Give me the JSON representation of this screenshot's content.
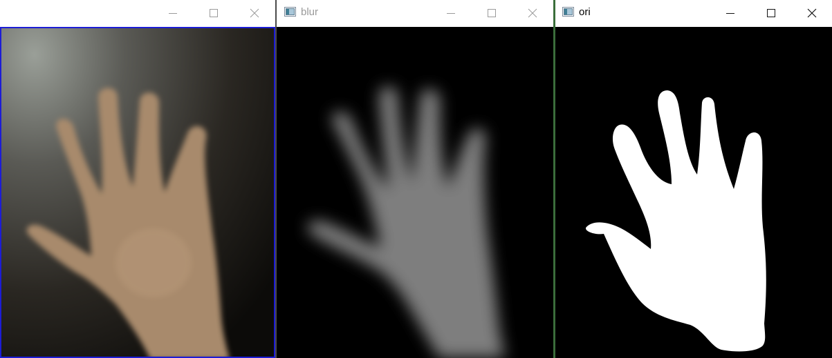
{
  "windows": [
    {
      "title": "",
      "active": false
    },
    {
      "title": "blur",
      "active": false
    },
    {
      "title": "ori",
      "active": true
    }
  ],
  "colors": {
    "active_title_text": "#000000",
    "inactive_title_text": "#999999",
    "camera_frame_border": "#1c1cd6",
    "window_separator": "#3b6e3b"
  },
  "icons": {
    "minimize": "minimize-icon",
    "maximize": "maximize-icon",
    "close": "close-icon",
    "window_app": "window-app-icon"
  }
}
